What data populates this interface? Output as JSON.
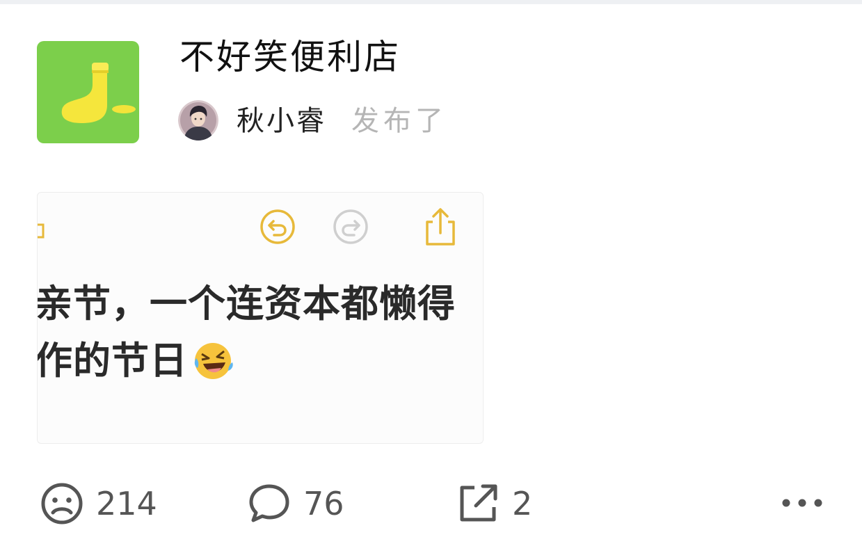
{
  "post": {
    "group_name": "不好笑便利店",
    "author": "秋小睿",
    "action_text": "发布了",
    "icon": "sock-icon",
    "icon_bg": "#7ccf4b"
  },
  "preview": {
    "line1": "亲节，一个连资本都懒得",
    "line2": "作的节日",
    "emoji": "rolling-laughing-emoji",
    "toolbar_icons": [
      "undo-icon",
      "redo-icon",
      "share-icon"
    ],
    "accent": "#e7b93a"
  },
  "actions": {
    "like_count": "214",
    "comment_count": "76",
    "share_count": "2"
  }
}
